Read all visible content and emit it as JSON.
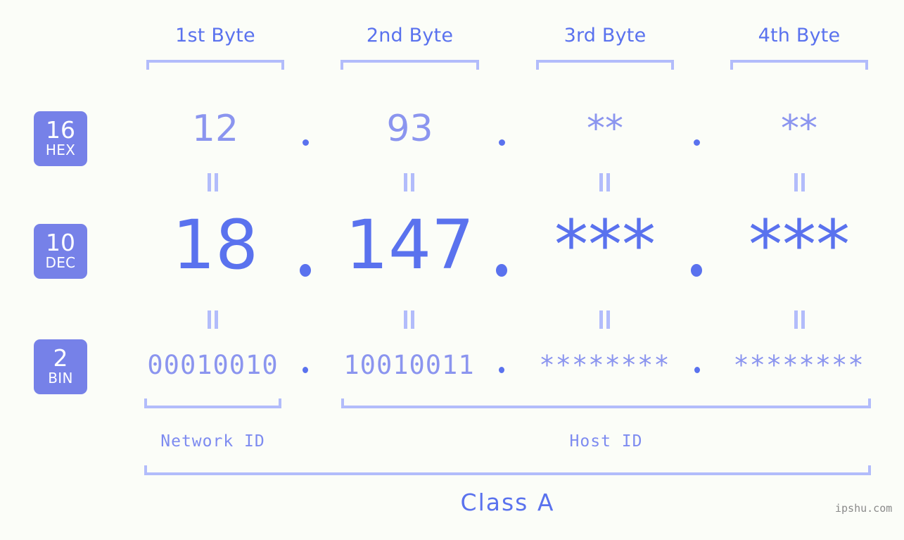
{
  "meta": {
    "background_color": "#fbfdf8",
    "accent_color": "#5a72ee",
    "accent_light_color": "#8b95ef",
    "bracket_color": "#b2bcfb",
    "badge_color": "#7681e8",
    "watermark": "ipshu.com"
  },
  "columns": [
    {
      "header": "1st Byte"
    },
    {
      "header": "2nd Byte"
    },
    {
      "header": "3rd Byte"
    },
    {
      "header": "4th Byte"
    }
  ],
  "rows": [
    {
      "key": "hex",
      "badge_number": "16",
      "badge_name": "HEX",
      "values": [
        "12",
        "93",
        "**",
        "**"
      ],
      "separator": "."
    },
    {
      "key": "dec",
      "badge_number": "10",
      "badge_name": "DEC",
      "values": [
        "18",
        "147",
        "***",
        "***"
      ],
      "separator": "."
    },
    {
      "key": "bin",
      "badge_number": "2",
      "badge_name": "BIN",
      "values": [
        "00010010",
        "10010011",
        "********",
        "********"
      ],
      "separator": "."
    }
  ],
  "equals_marker": "||",
  "sections": [
    {
      "label": "Network ID"
    },
    {
      "label": "Host ID"
    }
  ],
  "class_label": "Class A"
}
